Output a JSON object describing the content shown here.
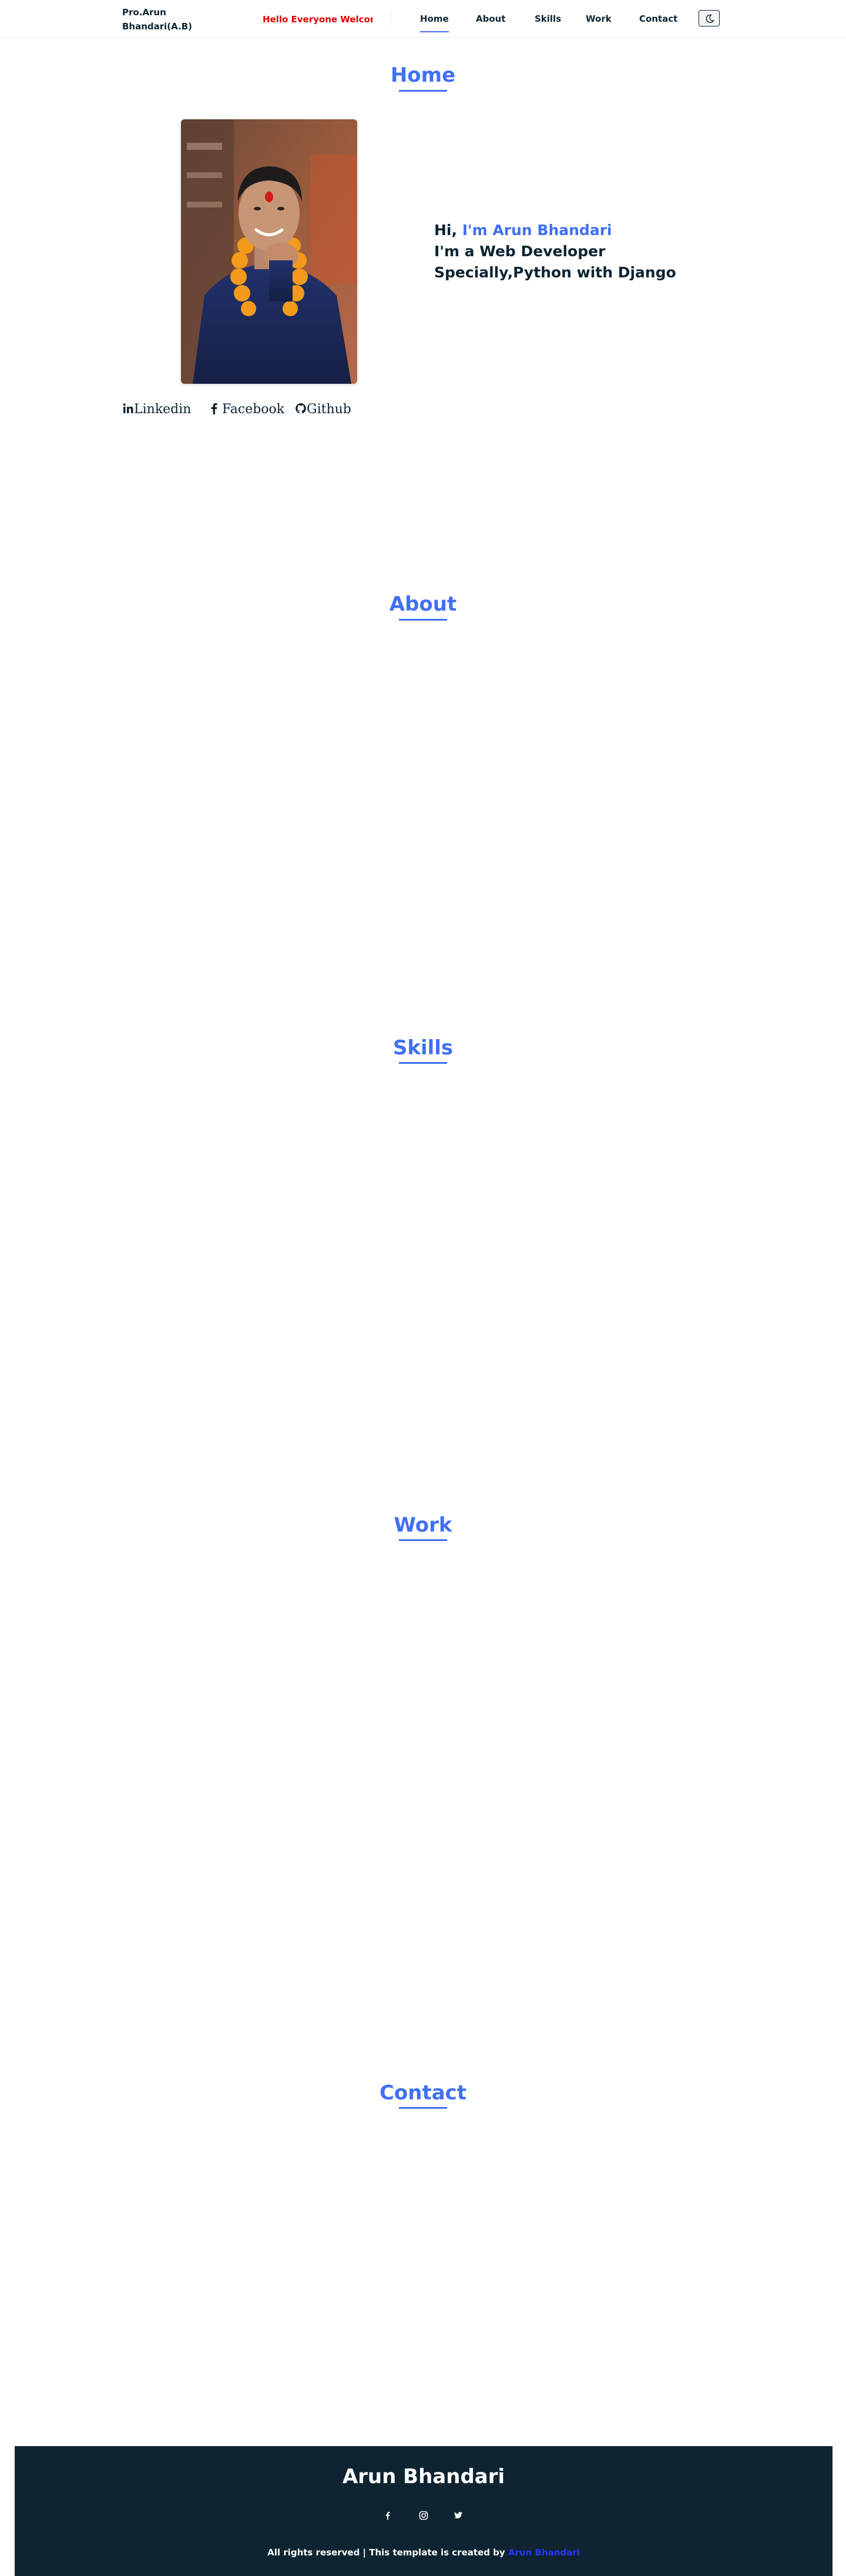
{
  "header": {
    "logo": "Pro.Arun Bhandari(A.B)",
    "marquee": "Hello Everyone Welcome",
    "nav": [
      {
        "label": "Home"
      },
      {
        "label": "About"
      },
      {
        "label": "Skills"
      },
      {
        "label": "Work"
      },
      {
        "label": "Contact"
      }
    ],
    "theme_icon": "moon-icon"
  },
  "home": {
    "title": "Home",
    "intro_hi": "Hi,",
    "intro_name": "I'm Arun Bhandari",
    "intro_line2": "I'm a Web Developer",
    "intro_line3": "Specially,Python with Django",
    "social": [
      {
        "label": "Linkedin",
        "icon": "linkedin-icon"
      },
      {
        "label": "Facebook",
        "icon": "facebook-icon"
      },
      {
        "label": "Github",
        "icon": "github-icon"
      }
    ]
  },
  "about": {
    "title": "About"
  },
  "skills": {
    "title": "Skills"
  },
  "work": {
    "title": "Work"
  },
  "contact": {
    "title": "Contact"
  },
  "footer": {
    "title": "Arun Bhandari",
    "icons": [
      "facebook-icon",
      "instagram-icon",
      "twitter-icon"
    ],
    "copyright": "All rights reserved | This template is created by",
    "author_link": "Arun Bhandari"
  },
  "colors": {
    "accent": "#4070f4",
    "text": "#0e2431",
    "marquee": "#e00000",
    "footer_bg": "#0e2431",
    "link": "#2b34ff"
  }
}
